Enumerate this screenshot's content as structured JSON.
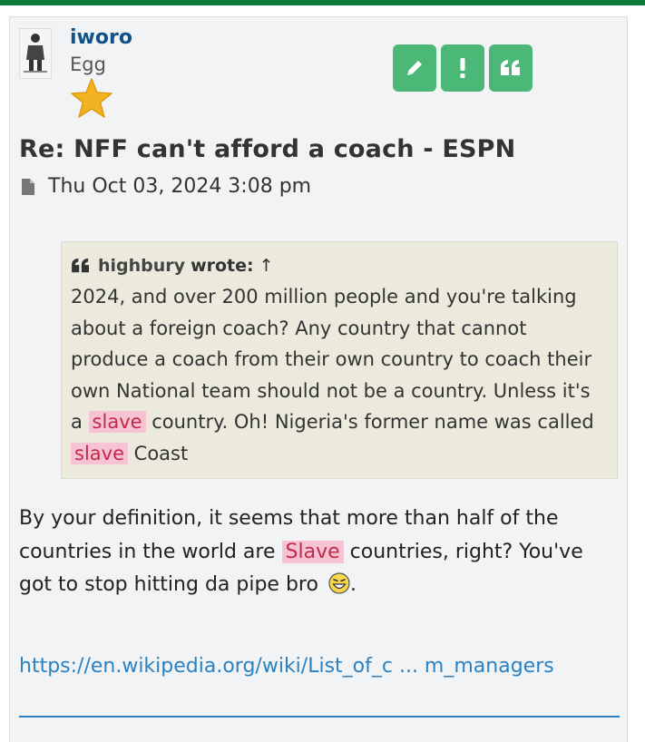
{
  "post": {
    "author": "iworo",
    "rank": "Egg",
    "title": "Re: NFF can't afford a coach - ESPN",
    "timestamp": "Thu Oct 03, 2024 3:08 pm",
    "buttons": {
      "edit_icon": "pencil-icon",
      "report_icon": "exclamation-icon",
      "quote_icon": "quote-icon"
    },
    "quote": {
      "author": "highbury",
      "wrote_label": "wrote:",
      "arrow": "↑",
      "seg1": "2024, and over 200 million people and you're talking about a foreign coach?      Any country that cannot produce a coach from their own country to coach their own National team should not be a country. Unless it's a ",
      "hl1": "slave",
      "seg2": " country. Oh! Nigeria's former name was called ",
      "hl2": "slave",
      "seg3": " Coast"
    },
    "body": {
      "seg1": "By your definition, it seems that more than half of the countries in the world are ",
      "hl1": "Slave",
      "seg2": " countries, right? You've got to stop hitting da pipe bro "
    },
    "link_text": "https://en.wikipedia.org/wiki/List_of_c ... m_managers"
  },
  "colors": {
    "accent_green": "#4cb878",
    "link_blue": "#2a82c4",
    "username_blue": "#105289",
    "highlight_bg": "#f5c3d3",
    "highlight_text": "#c32a4a"
  }
}
